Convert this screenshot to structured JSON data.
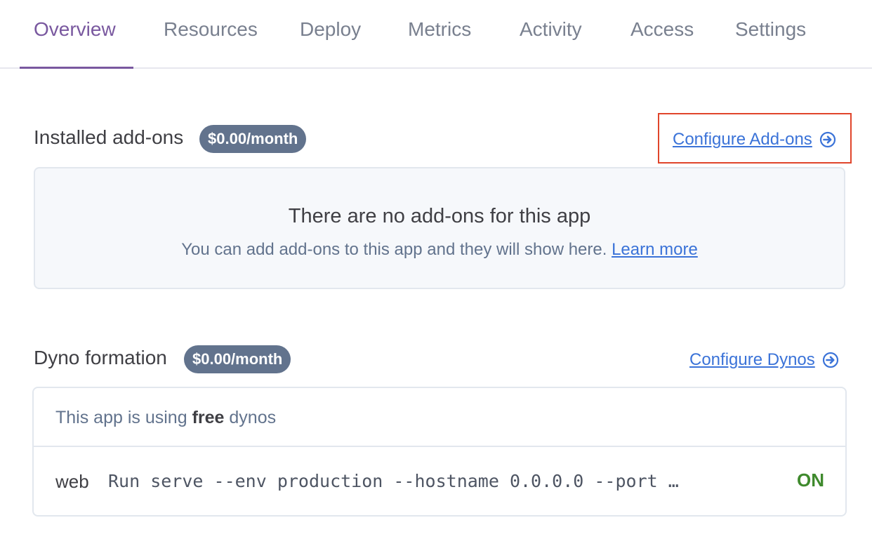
{
  "tabs": [
    {
      "label": "Overview",
      "active": true
    },
    {
      "label": "Resources"
    },
    {
      "label": "Deploy"
    },
    {
      "label": "Metrics"
    },
    {
      "label": "Activity"
    },
    {
      "label": "Access"
    },
    {
      "label": "Settings"
    }
  ],
  "addons": {
    "title": "Installed add-ons",
    "price": "$0.00/month",
    "configure_label": "Configure Add-ons",
    "empty_title": "There are no add-ons for this app",
    "empty_sub": "You can add add-ons to this app and they will show here.",
    "learn_more": "Learn more"
  },
  "dynos": {
    "title": "Dyno formation",
    "price": "$0.00/month",
    "configure_label": "Configure Dynos",
    "info_prefix": "This app is using",
    "info_bold": "free",
    "info_suffix": "dynos",
    "rows": [
      {
        "type": "web",
        "command": "Run serve --env production --hostname 0.0.0.0 --port …",
        "status": "ON"
      }
    ]
  },
  "colors": {
    "accent": "#79589f",
    "link": "#3b73d8",
    "badge": "#62738d",
    "highlight": "#e0452b",
    "status_on": "#3f8a2d"
  }
}
